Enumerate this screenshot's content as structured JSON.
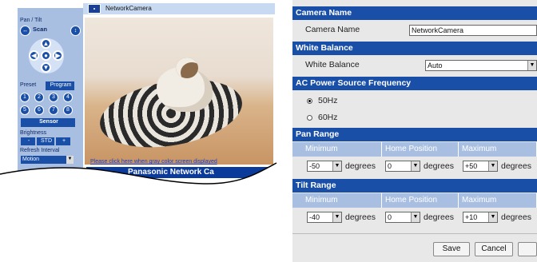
{
  "preview": {
    "window_title": "NetworkCamera",
    "pan_tilt_label": "Pan / Tilt",
    "scan_label": "Scan",
    "preset_label": "Preset",
    "program_label": "Program",
    "preset_numbers": [
      "1",
      "2",
      "3",
      "4",
      "5",
      "6",
      "7",
      "8"
    ],
    "sensor_label": "Sensor",
    "brightness_label": "Brightness",
    "brightness_minus": "-",
    "brightness_std": "STD",
    "brightness_plus": "+",
    "refresh_label": "Refresh Interval",
    "refresh_value": "Motion",
    "gray_screen_link": "Please click here when gray color screen displayed",
    "brand_text": "Panasonic  Network Ca"
  },
  "settings": {
    "camera_name": {
      "header": "Camera Name",
      "label": "Camera Name",
      "value": "NetworkCamera"
    },
    "white_balance": {
      "header": "White Balance",
      "label": "White Balance",
      "value": "Auto"
    },
    "ac_power": {
      "header": "AC Power Source Frequency",
      "options": [
        "50Hz",
        "60Hz"
      ],
      "selected": "50Hz"
    },
    "pan_range": {
      "header": "Pan Range",
      "columns": [
        "Minimum",
        "Home Position",
        "Maximum"
      ],
      "values": [
        "-50",
        "0",
        "+50"
      ],
      "unit": "degrees"
    },
    "tilt_range": {
      "header": "Tilt Range",
      "columns": [
        "Minimum",
        "Home Position",
        "Maximum"
      ],
      "values": [
        "-40",
        "0",
        "+10"
      ],
      "unit": "degrees"
    },
    "save_label": "Save",
    "cancel_label": "Cancel"
  },
  "colors": {
    "accent": "#1a4fa8",
    "subheader": "#a9bfe2",
    "panel_bg": "#e8e8e8"
  }
}
